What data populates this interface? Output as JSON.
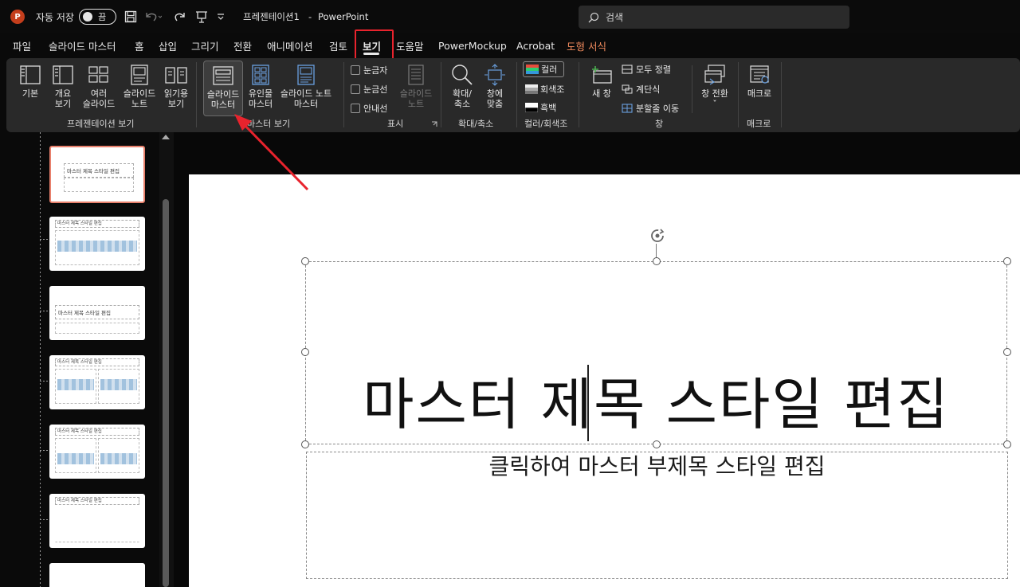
{
  "titlebar": {
    "logo_letter": "P",
    "autosave_label": "자동 저장",
    "autosave_state": "끔",
    "icons": [
      "save-icon",
      "undo-icon",
      "redo-icon",
      "slideshow-icon",
      "customize-icon"
    ],
    "document_name": "프레젠테이션1",
    "separator": "-",
    "app_name": "PowerPoint",
    "search_placeholder": "검색"
  },
  "menu": {
    "tabs": [
      "파일",
      "슬라이드 마스터",
      "홈",
      "삽입",
      "그리기",
      "전환",
      "애니메이션",
      "검토",
      "보기",
      "도움말",
      "PowerMockup",
      "Acrobat",
      "도형 서식"
    ],
    "active_tab": "보기"
  },
  "ribbon": {
    "presentation_views": {
      "label": "프레젠테이션 보기",
      "buttons": [
        {
          "line1": "기본",
          "line2": ""
        },
        {
          "line1": "개요",
          "line2": "보기"
        },
        {
          "line1": "여러",
          "line2": "슬라이드"
        },
        {
          "line1": "슬라이드",
          "line2": "노트"
        },
        {
          "line1": "읽기용",
          "line2": "보기"
        }
      ]
    },
    "master_views": {
      "label": "마스터 보기",
      "buttons": [
        {
          "line1": "슬라이드",
          "line2": "마스터"
        },
        {
          "line1": "유인물",
          "line2": "마스터"
        },
        {
          "line1": "슬라이드 노트",
          "line2": "마스터"
        }
      ]
    },
    "show": {
      "label": "표시",
      "checkboxes": [
        "눈금자",
        "눈금선",
        "안내선"
      ],
      "notes_line1": "슬라이드",
      "notes_line2": "노트"
    },
    "zoom": {
      "label": "확대/축소",
      "zoom_line1": "확대/",
      "zoom_line2": "축소",
      "fit_line1": "창에",
      "fit_line2": "맞춤"
    },
    "color": {
      "label": "컬러/회색조",
      "options": [
        "컬러",
        "회색조",
        "흑백"
      ]
    },
    "window": {
      "label": "창",
      "new_window": "새 창",
      "arrange_all": "모두 정렬",
      "cascade": "계단식",
      "move_split": "분할줄 이동",
      "switch_line1": "창 전환",
      "switch_line2": "ˇ"
    },
    "macros": {
      "label": "매크로",
      "button": "매크로"
    }
  },
  "thumbnails": [
    {
      "kind": "master",
      "title": "마스터 제목 스타일 편집",
      "selected": true
    },
    {
      "kind": "title-content",
      "title": "마스터 제목 스타일 편집",
      "selected": false
    },
    {
      "kind": "section",
      "title": "마스터 제목 스타일 편집",
      "selected": false
    },
    {
      "kind": "two-content",
      "title": "마스터 제목 스타일 편집",
      "selected": false
    },
    {
      "kind": "comparison",
      "title": "마스터 제목 스타일 편집",
      "selected": false
    },
    {
      "kind": "title-only",
      "title": "마스터 제목 스타일 편집",
      "selected": false
    },
    {
      "kind": "blank",
      "title": "",
      "selected": false
    }
  ],
  "slide": {
    "title": "마스터 제목 스타일 편집",
    "subtitle": "클릭하여 마스터 부제목 스타일 편집"
  },
  "colors": {
    "accent_red": "#e8232d",
    "ppt_orange": "#c43e1c",
    "shape_format_tab": "#f08a5d",
    "selected_thumb_border": "#e8806c"
  }
}
